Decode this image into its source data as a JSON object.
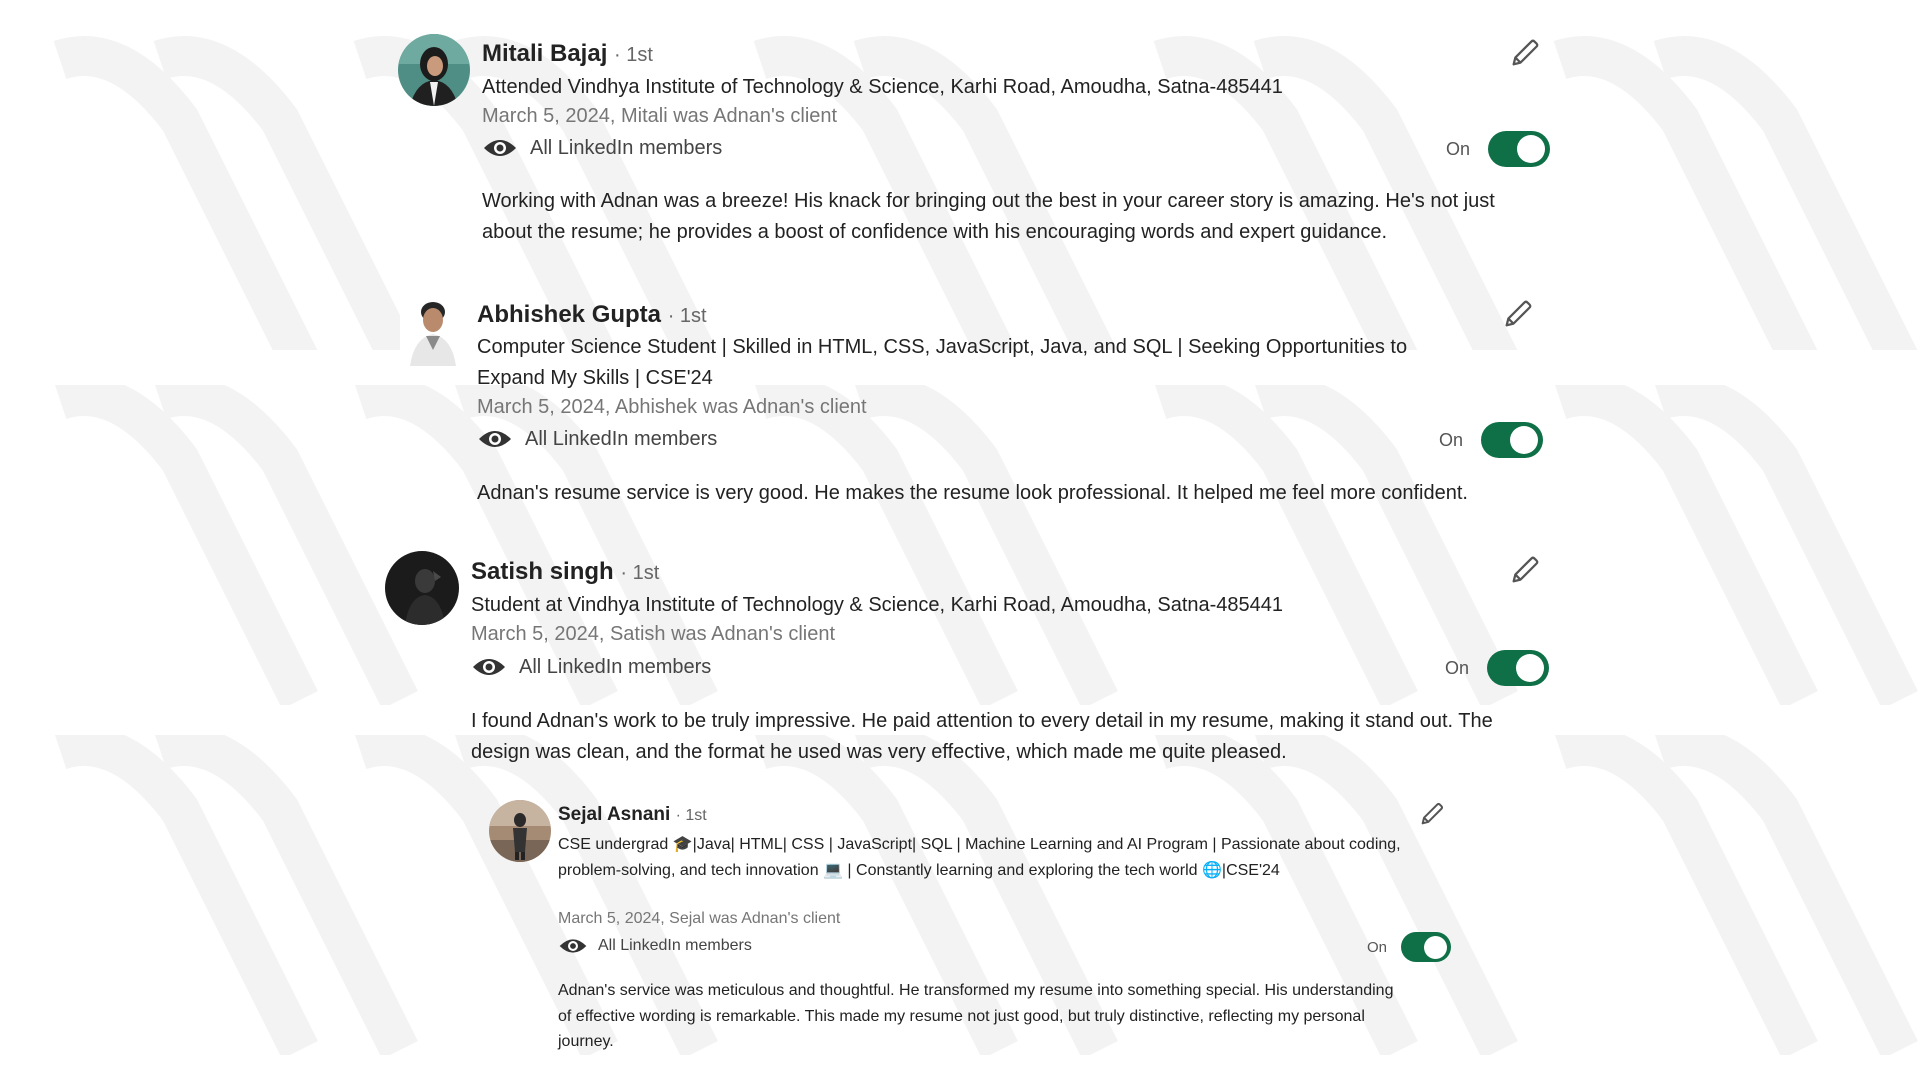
{
  "recommendations": [
    {
      "name": "Mitali Bajaj",
      "degree": "· 1st",
      "headline": "Attended Vindhya Institute of Technology & Science, Karhi Road, Amoudha, Satna-485441",
      "date": "March 5, 2024, Mitali was Adnan's client",
      "visibility_label": "All LinkedIn members",
      "toggle_label": "On",
      "toggle_on": true,
      "body": "Working with Adnan was a breeze! His knack for bringing out the best in your career story is amazing. He's not just about the resume; he provides a boost of confidence with his encouraging words and expert guidance."
    },
    {
      "name": "Abhishek Gupta",
      "degree": "· 1st",
      "headline": "Computer Science Student | Skilled in HTML, CSS, JavaScript, Java, and SQL | Seeking Opportunities to Expand My Skills | CSE'24",
      "date": "March 5, 2024, Abhishek was Adnan's client",
      "visibility_label": "All LinkedIn members",
      "toggle_label": "On",
      "toggle_on": true,
      "body": "Adnan's resume service is very good. He makes the resume look professional. It helped me feel more confident."
    },
    {
      "name": "Satish singh",
      "degree": "· 1st",
      "headline": "Student at Vindhya Institute of Technology & Science, Karhi Road, Amoudha, Satna-485441",
      "date": "March 5, 2024, Satish was Adnan's client",
      "visibility_label": "All LinkedIn members",
      "toggle_label": "On",
      "toggle_on": true,
      "body": "I found Adnan's work to be truly impressive. He paid attention to every detail in my resume, making it stand out. The design was clean, and the format he used was very effective, which made me quite pleased."
    },
    {
      "name": "Sejal Asnani",
      "degree": "· 1st",
      "headline": "CSE undergrad 🎓|Java| HTML| CSS | JavaScript| SQL | Machine Learning and AI Program | Passionate about coding, problem-solving, and tech innovation 💻 | Constantly learning and exploring the tech world 🌐|CSE'24",
      "date": "March 5, 2024, Sejal was Adnan's client",
      "visibility_label": "All LinkedIn members",
      "toggle_label": "On",
      "toggle_on": true,
      "body": "Adnan's service was meticulous and thoughtful. He transformed my resume into something special. His understanding of effective wording is remarkable. This made my resume not just good, but truly distinctive, reflecting my personal journey."
    }
  ],
  "colors": {
    "toggle_on": "#0f7047",
    "secondary_text": "#767676",
    "primary_text": "#222222"
  },
  "icons": {
    "edit": "pencil-icon",
    "visibility": "eye-icon"
  }
}
